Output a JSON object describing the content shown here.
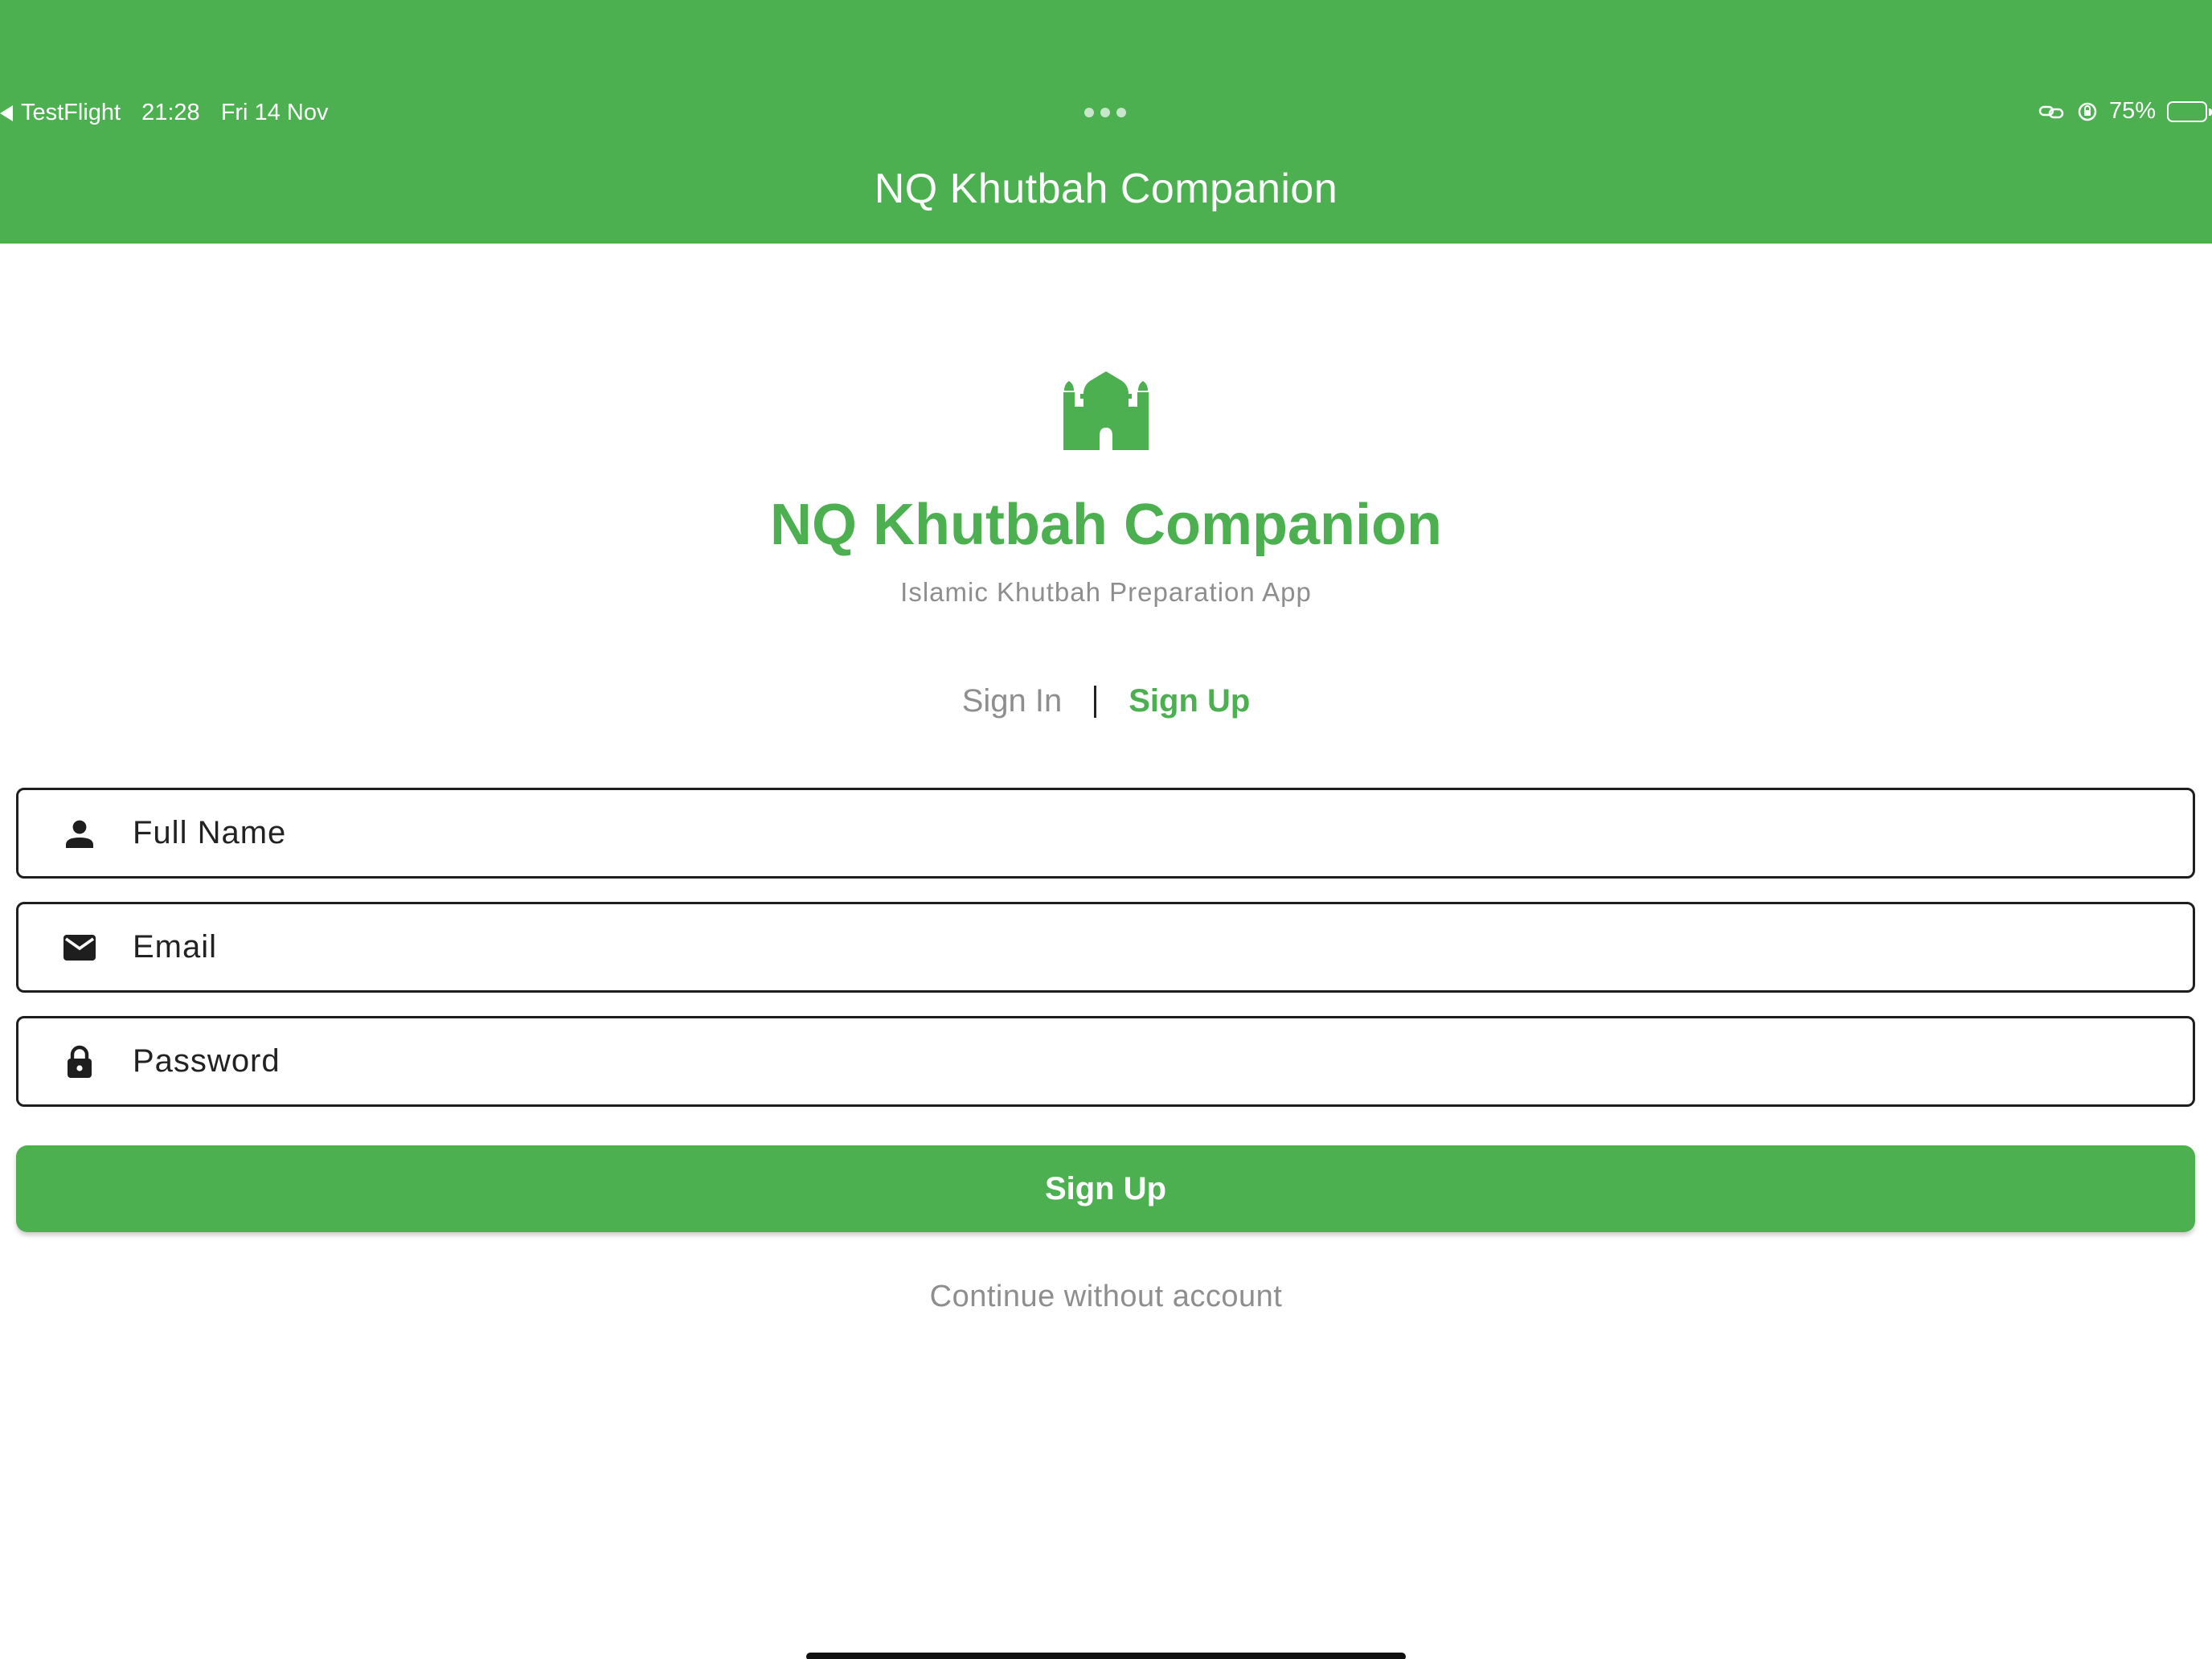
{
  "status_bar": {
    "back_app": "TestFlight",
    "time": "21:28",
    "date": "Fri 14 Nov",
    "battery_percent": "75%",
    "battery_level": 0.75
  },
  "app_bar": {
    "title": "NQ Khutbah Companion"
  },
  "branding": {
    "icon": "mosque-icon",
    "title": "NQ Khutbah Companion",
    "subtitle": "Islamic Khutbah Preparation App"
  },
  "tabs": {
    "sign_in": "Sign In",
    "sign_up": "Sign Up",
    "active": "sign_up"
  },
  "form": {
    "full_name": {
      "placeholder": "Full Name",
      "value": "",
      "icon": "person-icon"
    },
    "email": {
      "placeholder": "Email",
      "value": "",
      "icon": "mail-icon"
    },
    "password": {
      "placeholder": "Password",
      "value": "",
      "icon": "lock-icon"
    },
    "submit_label": "Sign Up"
  },
  "continue_label": "Continue without account",
  "colors": {
    "primary": "#4caf50",
    "muted_text": "#8e8e8e",
    "field_border": "#1e1e1e"
  }
}
